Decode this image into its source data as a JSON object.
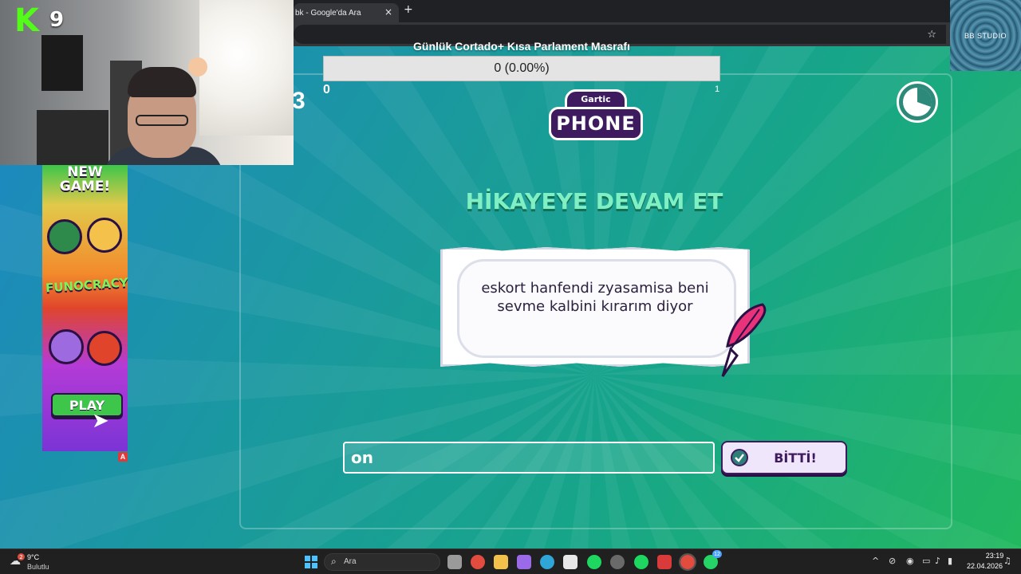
{
  "browser": {
    "tab_title": "bk - Google'da Ara",
    "tab_close": "×",
    "new_tab": "+",
    "star_icon": "☆"
  },
  "cost_overlay": {
    "title": "Günlük Cortado+ Kısa Parlament Masrafı",
    "value_text": "0 (0.00%)",
    "progress": 0,
    "min_label": "0",
    "max_label": "1",
    "side_digit": "3"
  },
  "game": {
    "logo_small": "Gartic",
    "logo_main": "PHONE",
    "heading": "HİKAYEYE DEVAM ET",
    "story_text": "eskort hanfendi zyasamisa beni sevme kalbini kırarım diyor",
    "input_value": "on",
    "done_label": "BİTTİ!"
  },
  "ad": {
    "headline_line1": "NEW",
    "headline_line2": "GAME!",
    "brand": "FUNOCRACY",
    "play_label": "PLAY",
    "badge": "A"
  },
  "webcam": {
    "kick_logo": "K",
    "kick_number": "9"
  },
  "corner_overlay": {
    "label": "BB STUDIO"
  },
  "taskbar": {
    "weather_temp": "9°C",
    "weather_desc": "Bulutlu",
    "weather_badge": "2",
    "search_label": "Ara",
    "whatsapp_badge": "12",
    "time": "23:19",
    "date": "22.04.2026"
  },
  "colors": {
    "heading": "#7ef0c4",
    "button_bg": "#efe6fb",
    "brand_purple": "#3d1b5e",
    "kick_green": "#53fc18"
  }
}
